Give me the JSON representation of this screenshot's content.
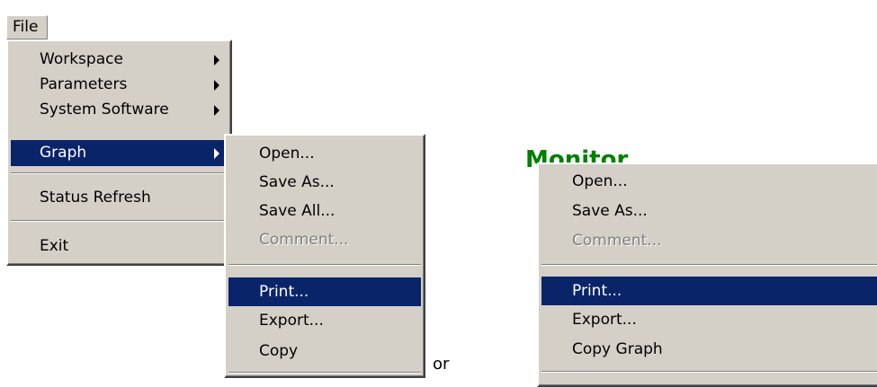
{
  "menubar": {
    "file_label": "File"
  },
  "file_menu": {
    "items": [
      {
        "label": "Workspace"
      },
      {
        "label": "Parameters"
      },
      {
        "label": "System Software"
      },
      {
        "label": "Graph"
      },
      {
        "label": "Status Refresh"
      },
      {
        "label": "Exit"
      }
    ]
  },
  "graph_submenu": {
    "items": [
      {
        "label": "Open..."
      },
      {
        "label": "Save As..."
      },
      {
        "label": "Save All..."
      },
      {
        "label": "Comment..."
      },
      {
        "label": "Print..."
      },
      {
        "label": "Export..."
      },
      {
        "label": "Copy"
      }
    ]
  },
  "separator_text": "or",
  "background_title": "Monitor",
  "context_menu": {
    "items": [
      {
        "label": "Open..."
      },
      {
        "label": "Save As..."
      },
      {
        "label": "Comment..."
      },
      {
        "label": "Print..."
      },
      {
        "label": "Export..."
      },
      {
        "label": "Copy Graph"
      }
    ]
  },
  "colors": {
    "menu_bg": "#d4d0c8",
    "highlight": "#0a246a",
    "highlight_text": "#ffffff",
    "disabled_text": "#808080",
    "title_green": "#008000"
  }
}
